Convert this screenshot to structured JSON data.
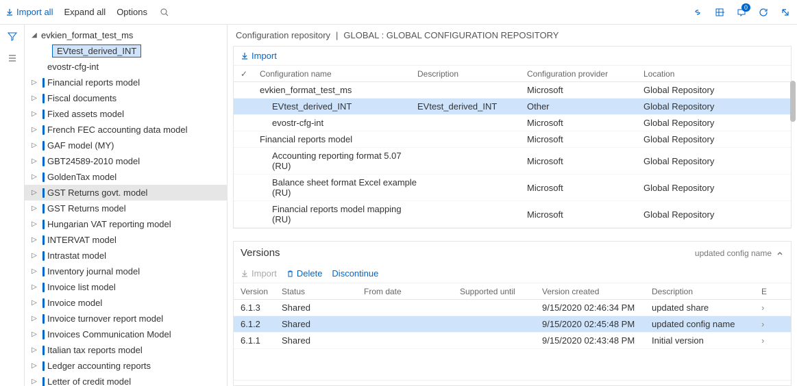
{
  "topbar": {
    "import_all": "Import all",
    "expand_all": "Expand all",
    "options": "Options",
    "badge": "0"
  },
  "tree": {
    "root": "evkien_format_test_ms",
    "selected_child": "EVtest_derived_INT",
    "items": [
      {
        "label": "evostr-cfg-int",
        "bar": false,
        "expander": ""
      },
      {
        "label": "Financial reports model",
        "bar": true,
        "expander": "▷"
      },
      {
        "label": "Fiscal documents",
        "bar": true,
        "expander": "▷"
      },
      {
        "label": "Fixed assets model",
        "bar": true,
        "expander": "▷"
      },
      {
        "label": "French FEC accounting data model",
        "bar": true,
        "expander": "▷"
      },
      {
        "label": "GAF model (MY)",
        "bar": true,
        "expander": "▷"
      },
      {
        "label": "GBT24589-2010 model",
        "bar": true,
        "expander": "▷"
      },
      {
        "label": "GoldenTax model",
        "bar": true,
        "expander": "▷"
      },
      {
        "label": "GST Returns govt. model",
        "bar": true,
        "expander": "▷",
        "highlight": true
      },
      {
        "label": "GST Returns model",
        "bar": true,
        "expander": "▷"
      },
      {
        "label": "Hungarian VAT reporting model",
        "bar": true,
        "expander": "▷"
      },
      {
        "label": "INTERVAT model",
        "bar": true,
        "expander": "▷"
      },
      {
        "label": "Intrastat model",
        "bar": true,
        "expander": "▷"
      },
      {
        "label": "Inventory journal model",
        "bar": true,
        "expander": "▷"
      },
      {
        "label": "Invoice list model",
        "bar": true,
        "expander": "▷"
      },
      {
        "label": "Invoice model",
        "bar": true,
        "expander": "▷"
      },
      {
        "label": "Invoice turnover report model",
        "bar": true,
        "expander": "▷"
      },
      {
        "label": "Invoices Communication Model",
        "bar": true,
        "expander": "▷"
      },
      {
        "label": "Italian tax reports model",
        "bar": true,
        "expander": "▷"
      },
      {
        "label": "Ledger accounting reports",
        "bar": true,
        "expander": "▷"
      },
      {
        "label": "Letter of credit model",
        "bar": true,
        "expander": "▷"
      }
    ]
  },
  "breadcrumb": {
    "a": "Configuration repository",
    "b": "GLOBAL : GLOBAL CONFIGURATION REPOSITORY"
  },
  "config_panel": {
    "import_btn": "Import",
    "headers": {
      "name": "Configuration name",
      "desc": "Description",
      "prov": "Configuration provider",
      "loc": "Location"
    },
    "rows": [
      {
        "name": "evkien_format_test_ms",
        "desc": "",
        "prov": "Microsoft",
        "loc": "Global Repository",
        "indent": 0
      },
      {
        "name": "EVtest_derived_INT",
        "desc": "EVtest_derived_INT",
        "prov": "Other",
        "loc": "Global Repository",
        "indent": 1,
        "selected": true
      },
      {
        "name": "evostr-cfg-int",
        "desc": "",
        "prov": "Microsoft",
        "loc": "Global Repository",
        "indent": 1
      },
      {
        "name": "Financial reports model",
        "desc": "",
        "prov": "Microsoft",
        "loc": "Global Repository",
        "indent": 0
      },
      {
        "name": "Accounting reporting format 5.07 (RU)",
        "desc": "",
        "prov": "Microsoft",
        "loc": "Global Repository",
        "indent": 1
      },
      {
        "name": "Balance sheet format Excel example (RU)",
        "desc": "",
        "prov": "Microsoft",
        "loc": "Global Repository",
        "indent": 1
      },
      {
        "name": "Financial reports model mapping (RU)",
        "desc": "",
        "prov": "Microsoft",
        "loc": "Global Repository",
        "indent": 1
      }
    ]
  },
  "versions": {
    "title": "Versions",
    "subtitle": "updated config name",
    "import_btn": "Import",
    "delete_btn": "Delete",
    "discontinue_btn": "Discontinue",
    "headers": {
      "ver": "Version",
      "status": "Status",
      "from": "From date",
      "until": "Supported until",
      "created": "Version created",
      "desc": "Description",
      "e": "E"
    },
    "rows": [
      {
        "ver": "6.1.3",
        "status": "Shared",
        "from": "",
        "until": "",
        "created": "9/15/2020 02:46:34 PM",
        "desc": "updated share"
      },
      {
        "ver": "6.1.2",
        "status": "Shared",
        "from": "",
        "until": "",
        "created": "9/15/2020 02:45:48 PM",
        "desc": "updated config name",
        "selected": true
      },
      {
        "ver": "6.1.1",
        "status": "Shared",
        "from": "",
        "until": "",
        "created": "9/15/2020 02:43:48 PM",
        "desc": "Initial version"
      }
    ]
  }
}
